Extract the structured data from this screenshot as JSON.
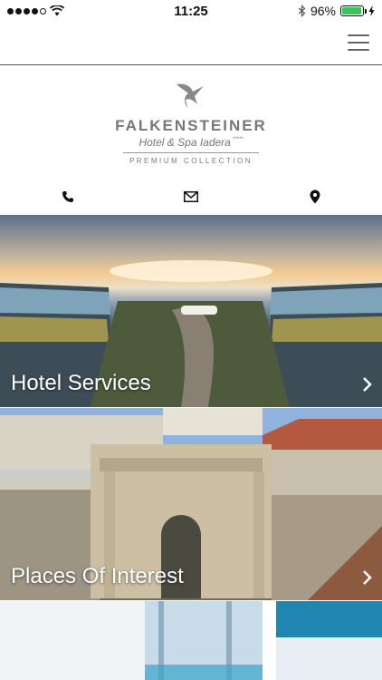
{
  "status_bar": {
    "time": "11:25",
    "battery": "96%",
    "signal_bars_filled": 4,
    "signal_bars_total": 5,
    "battery_level": 0.96,
    "colors": {
      "battery_fill": "#35c759"
    }
  },
  "header": {
    "menu_icon": "hamburger-menu-icon"
  },
  "logo": {
    "brand": "FALKENSTEINER",
    "subtitle": "Hotel & Spa Iadera",
    "stars": "*****",
    "collection": "PREMIUM COLLECTION",
    "icon": "swallow-bird-icon",
    "color": "#777777"
  },
  "contact": {
    "icons": [
      "phone-icon",
      "envelope-icon",
      "map-pin-icon"
    ]
  },
  "tiles": [
    {
      "title": "Hotel Services",
      "icon": "chevron-right-icon"
    },
    {
      "title": "Places Of Interest",
      "icon": "chevron-right-icon"
    },
    {
      "title": "",
      "icon": ""
    }
  ]
}
